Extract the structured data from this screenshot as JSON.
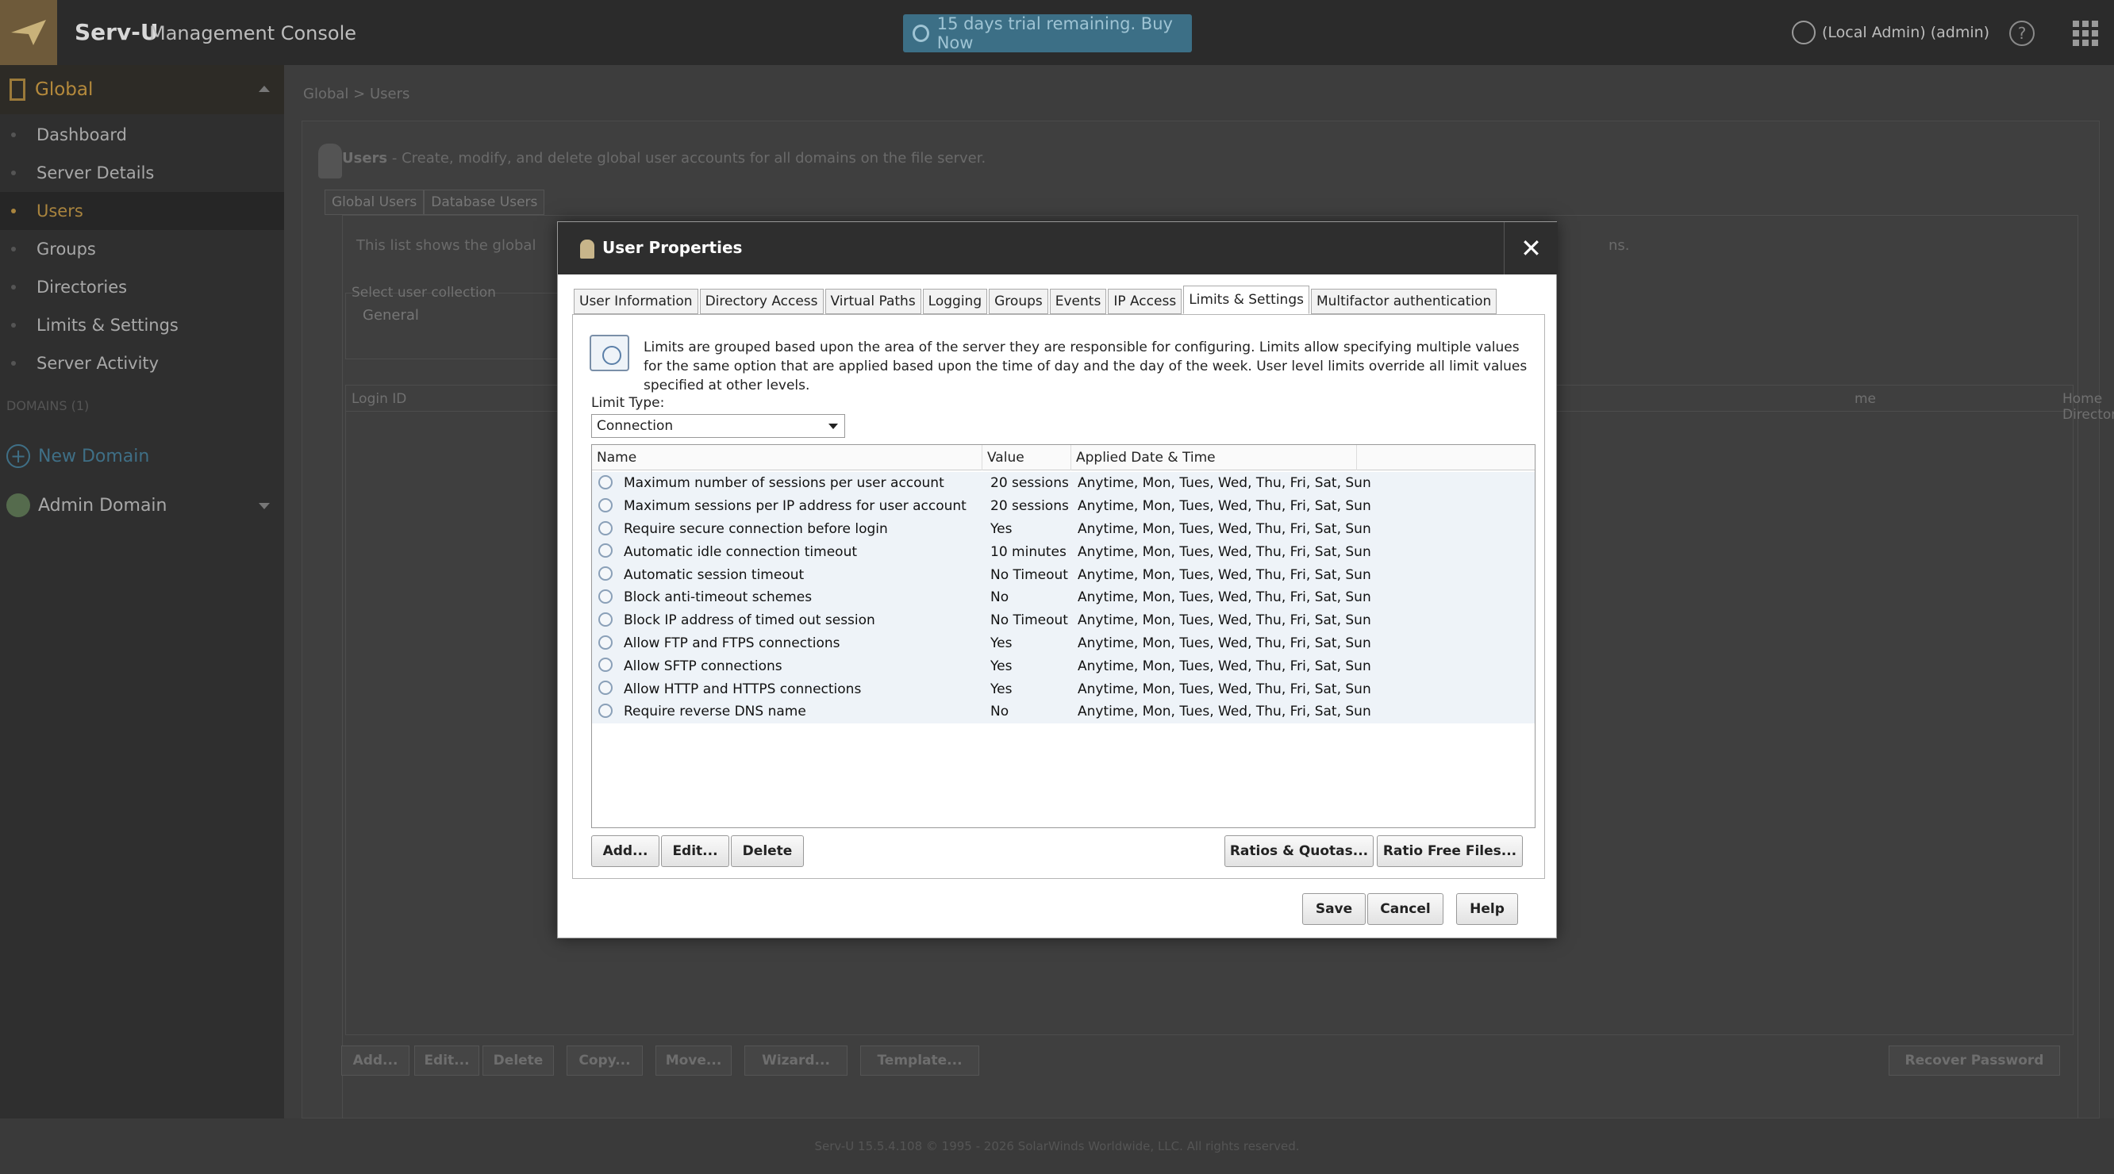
{
  "app": {
    "name": "Serv-U",
    "subtitle": "Management Console",
    "trial": "15 days trial remaining. Buy Now",
    "user": "(Local Admin) (admin)",
    "help": "?"
  },
  "sidebar": {
    "global_label": "Global",
    "items": [
      {
        "label": "Dashboard"
      },
      {
        "label": "Server Details"
      },
      {
        "label": "Users"
      },
      {
        "label": "Groups"
      },
      {
        "label": "Directories"
      },
      {
        "label": "Limits & Settings"
      },
      {
        "label": "Server Activity"
      }
    ],
    "domains_section": "DOMAINS (1)",
    "new_domain": "New Domain",
    "admin_domain": "Admin Domain"
  },
  "main": {
    "breadcrumb": "Global  >  Users",
    "desc_title": "Users",
    "desc_text": " - Create, modify, and delete global user accounts for all domains on the file server.",
    "tabs": [
      "Global Users",
      "Database Users"
    ],
    "list_desc": "This list shows the global",
    "list_desc_tail": "ns.",
    "collection_label": "Select user collection",
    "collection_value": "General",
    "col_login": "Login ID",
    "col_name": "me",
    "col_home": "Home Directory",
    "buttons": [
      "Add...",
      "Edit...",
      "Delete",
      "Copy...",
      "Move...",
      "Wizard...",
      "Template..."
    ],
    "recover": "Recover Password"
  },
  "footer": "Serv-U 15.5.4.108 © 1995 - 2026 SolarWinds Worldwide, LLC. All rights reserved.",
  "dialog": {
    "title": "User Properties",
    "close": "✕",
    "tabs": [
      "User Information",
      "Directory Access",
      "Virtual Paths",
      "Logging",
      "Groups",
      "Events",
      "IP Access",
      "Limits & Settings",
      "Multifactor authentication"
    ],
    "active_tab": "Limits & Settings",
    "info": "Limits are grouped based upon the area of the server they are responsible for configuring. Limits allow specifying multiple values for the same option that are applied based upon the time of day and the day of the week. User level limits override all limit values specified at other levels.",
    "limit_type_label": "Limit Type:",
    "limit_type_value": "Connection",
    "columns": [
      "Name",
      "Value",
      "Applied Date & Time"
    ],
    "rows": [
      {
        "name": "Maximum number of sessions per user account",
        "value": "20 sessions",
        "applied": "Anytime, Mon, Tues, Wed, Thu, Fri, Sat, Sun"
      },
      {
        "name": "Maximum sessions per IP address for user account",
        "value": "20 sessions",
        "applied": "Anytime, Mon, Tues, Wed, Thu, Fri, Sat, Sun"
      },
      {
        "name": "Require secure connection before login",
        "value": "Yes",
        "applied": "Anytime, Mon, Tues, Wed, Thu, Fri, Sat, Sun"
      },
      {
        "name": "Automatic idle connection timeout",
        "value": "10 minutes",
        "applied": "Anytime, Mon, Tues, Wed, Thu, Fri, Sat, Sun"
      },
      {
        "name": "Automatic session timeout",
        "value": "No Timeout",
        "applied": "Anytime, Mon, Tues, Wed, Thu, Fri, Sat, Sun"
      },
      {
        "name": "Block anti-timeout schemes",
        "value": "No",
        "applied": "Anytime, Mon, Tues, Wed, Thu, Fri, Sat, Sun"
      },
      {
        "name": "Block IP address of timed out session",
        "value": "No Timeout",
        "applied": "Anytime, Mon, Tues, Wed, Thu, Fri, Sat, Sun"
      },
      {
        "name": "Allow FTP and FTPS connections",
        "value": "Yes",
        "applied": "Anytime, Mon, Tues, Wed, Thu, Fri, Sat, Sun"
      },
      {
        "name": "Allow SFTP connections",
        "value": "Yes",
        "applied": "Anytime, Mon, Tues, Wed, Thu, Fri, Sat, Sun"
      },
      {
        "name": "Allow HTTP and HTTPS connections",
        "value": "Yes",
        "applied": "Anytime, Mon, Tues, Wed, Thu, Fri, Sat, Sun"
      },
      {
        "name": "Require reverse DNS name",
        "value": "No",
        "applied": "Anytime, Mon, Tues, Wed, Thu, Fri, Sat, Sun"
      }
    ],
    "btn_add": "Add...",
    "btn_edit": "Edit...",
    "btn_delete": "Delete",
    "btn_ratios": "Ratios & Quotas...",
    "btn_ratio_free": "Ratio Free Files...",
    "btn_save": "Save",
    "btn_cancel": "Cancel",
    "btn_help": "Help"
  }
}
